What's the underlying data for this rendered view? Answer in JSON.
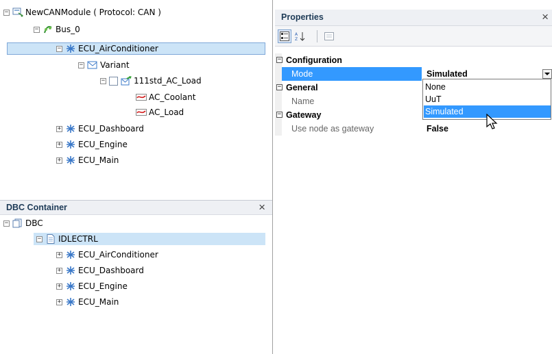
{
  "tree": {
    "root": "NewCANModule ( Protocol: CAN )",
    "bus": "Bus_0",
    "ecu_selected": "ECU_AirConditioner",
    "variant": "Variant",
    "load_node": "111std_AC_Load",
    "signals": [
      "AC_Coolant",
      "AC_Load"
    ],
    "ecus": [
      "ECU_Dashboard",
      "ECU_Engine",
      "ECU_Main"
    ]
  },
  "dbc": {
    "title": "DBC Container",
    "close": "×",
    "root": "DBC",
    "ctrl": "IDLECTRL",
    "ecus": [
      "ECU_AirConditioner",
      "ECU_Dashboard",
      "ECU_Engine",
      "ECU_Main"
    ]
  },
  "props": {
    "title": "Properties",
    "close": "×",
    "categories": {
      "configuration": "Configuration",
      "general": "General",
      "gateway": "Gateway"
    },
    "rows": {
      "mode_name": "Mode",
      "mode_value": "Simulated",
      "name_name": "Name",
      "gateway_name": "Use node as gateway",
      "gateway_value": "False"
    },
    "dropdown_options": [
      "None",
      "UuT",
      "Simulated"
    ],
    "dropdown_selected": "Simulated"
  },
  "colors": {
    "selection": "#3399ff",
    "tree_selection": "#cce4f7",
    "header_bg": "#eef0f4"
  }
}
